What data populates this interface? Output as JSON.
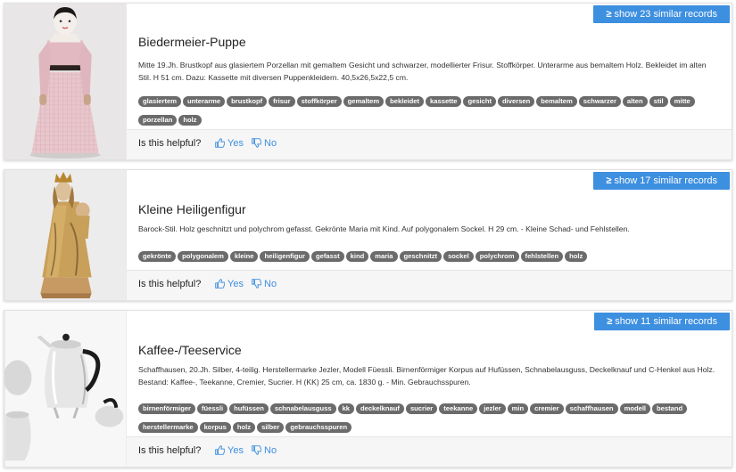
{
  "feedback": {
    "question": "Is this helpful?",
    "yes": "Yes",
    "no": "No"
  },
  "records": [
    {
      "similar_label": "show 23 similar records",
      "title": "Biedermeier-Puppe",
      "description": "Mitte 19.Jh. Brustkopf aus glasiertem Porzellan mit gemaltem Gesicht und schwarzer, modellierter Frisur. Stoffkörper. Unterarme aus bemaltem Holz. Bekleidet im alten Stil. H 51 cm. Dazu: Kassette mit diversen Puppenkleidern. 40,5x26,5x22,5 cm.",
      "tags": [
        "glasiertem",
        "unterarme",
        "brustkopf",
        "frisur",
        "stoffkörper",
        "gemaltem",
        "bekleidet",
        "kassette",
        "gesicht",
        "diversen",
        "bemaltem",
        "schwarzer",
        "alten",
        "stil",
        "mitte",
        "porzellan",
        "holz"
      ],
      "image": "doll-photo"
    },
    {
      "similar_label": "show 17 similar records",
      "title": "Kleine Heiligenfigur",
      "description": "Barock-Stil. Holz geschnitzt und polychrom gefasst. Gekrönte Maria mit Kind. Auf polygonalem Sockel. H 29 cm. - Kleine Schad- und Fehlstellen.",
      "tags": [
        "gekrönte",
        "polygonalem",
        "kleine",
        "heiligenfigur",
        "gefasst",
        "kind",
        "maria",
        "geschnitzt",
        "sockel",
        "polychrom",
        "fehlstellen",
        "holz"
      ],
      "image": "madonna-figure-photo"
    },
    {
      "similar_label": "show 11 similar records",
      "title": "Kaffee-/Teeservice",
      "description": "Schaffhausen, 20.Jh. Silber, 4-teilig. Herstellermarke Jezler, Modell Füessli. Birnenförmiger Korpus auf Hufüssen, Schnabelausguss, Deckelknauf und C-Henkel aus Holz. Bestand: Kaffee-, Teekanne, Cremier, Sucrier. H (KK) 25 cm, ca. 1830 g. - Min. Gebrauchsspuren.",
      "tags": [
        "birnenförmiger",
        "füessli",
        "hufüssen",
        "schnabelausguss",
        "kk",
        "deckelknauf",
        "sucrier",
        "teekanne",
        "jezler",
        "min",
        "cremier",
        "schaffhausen",
        "modell",
        "bestand",
        "herstellermarke",
        "korpus",
        "holz",
        "silber",
        "gebrauchsspuren"
      ],
      "image": "silver-coffee-set-photo"
    }
  ]
}
